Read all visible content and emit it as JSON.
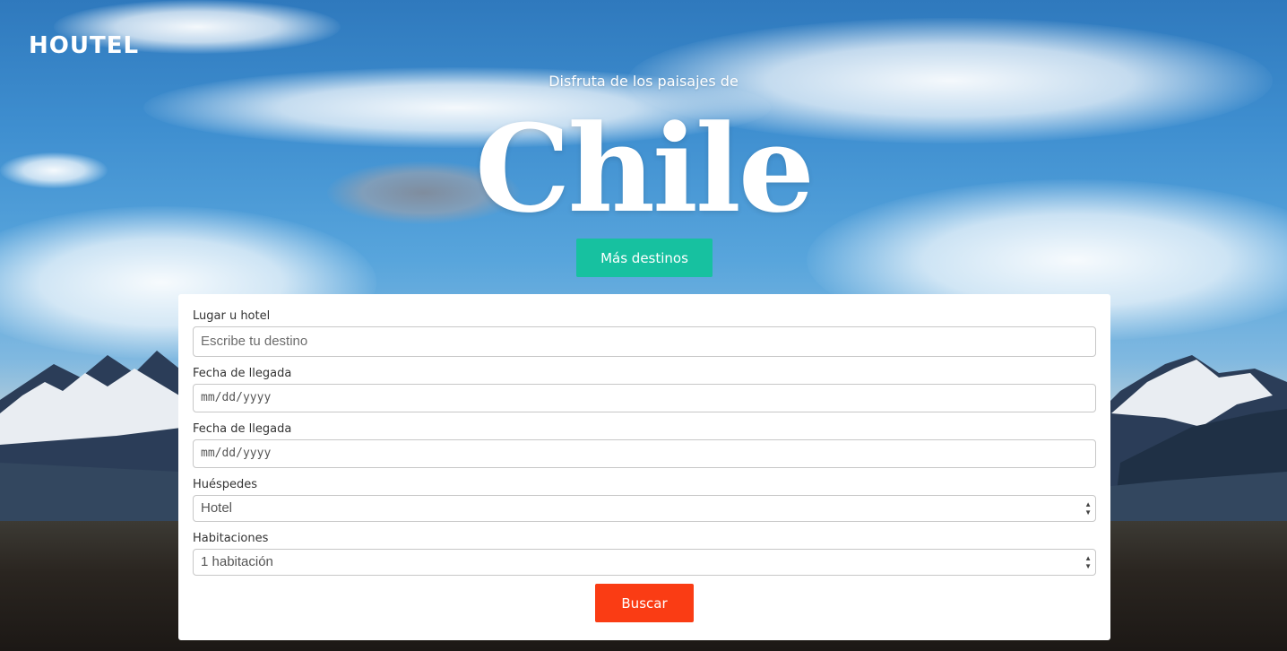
{
  "brand": {
    "name": "HOUTEL"
  },
  "hero": {
    "tagline": "Disfruta de los paisajes de",
    "destination": "Chile",
    "cta_label": "Más destinos"
  },
  "form": {
    "place": {
      "label": "Lugar u hotel",
      "placeholder": "Escribe tu destino"
    },
    "arrival": {
      "label": "Fecha de llegada",
      "placeholder": "mm/dd/yyyy"
    },
    "departure": {
      "label": "Fecha de llegada",
      "placeholder": "mm/dd/yyyy"
    },
    "guests": {
      "label": "Huéspedes",
      "value": "Hotel"
    },
    "rooms": {
      "label": "Habitaciones",
      "value": "1 habitación"
    },
    "submit_label": "Buscar"
  },
  "colors": {
    "cta": "#17c1a0",
    "submit": "#fa3c14"
  }
}
